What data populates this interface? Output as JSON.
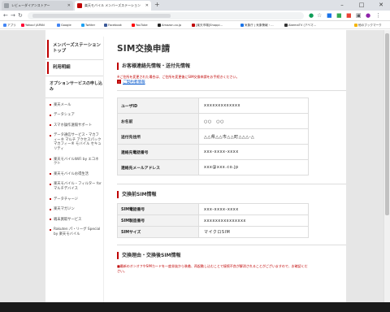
{
  "browser": {
    "tabs": [
      {
        "title": "レビューダイアンストアー",
        "active": false,
        "favicon_color": "#9aa0a6"
      },
      {
        "title": "楽天モバイル メンバーズステーション",
        "active": true,
        "favicon_color": "#bf0000"
      }
    ],
    "new_tab": "+",
    "window_controls": {
      "minimize": "–",
      "maximize": "□",
      "close": "✕"
    },
    "bookmarks": [
      {
        "label": "アプリ",
        "color": "#4285f4"
      },
      {
        "label": "Yahoo! JAPAN",
        "color": "#ff0033"
      },
      {
        "label": "Google",
        "color": "#4285f4"
      },
      {
        "label": "Twitter",
        "color": "#1da1f2"
      },
      {
        "label": "Facebook",
        "color": "#3b5998"
      },
      {
        "label": "YouTube",
        "color": "#ff0000"
      },
      {
        "label": "Amazon.co.jp",
        "color": "#222222"
      },
      {
        "label": "[楽天市場]Shoppi...",
        "color": "#bf0000"
      },
      {
        "label": "気象庁 | 気象警報・...",
        "color": "#1a73e8"
      },
      {
        "label": "AbemaTV (アベマ...",
        "color": "#333333"
      }
    ],
    "other_bookmarks": "他のブックマーク"
  },
  "sidebar": {
    "header": "メンバーズステーショントップ",
    "usage": "利用明細",
    "options_header": "オプションサービスの申し込み",
    "items": [
      "楽天メール",
      "データシェア",
      "スマホ操作遠隔サポート",
      "データ通信サービス・マカフィー® マルチ アクセスパック マカフィー® モバイル セキュリティ",
      "楽天モバイルWiFi by エコネクト",
      "楽天モバイルお得生活",
      "楽天モバイル・フィルター for マルチデバイス",
      "データチャージ",
      "楽天マガジン",
      "端末買取サービス",
      "Rakuten パ・リーグ Special by 楽天モバイル"
    ]
  },
  "main": {
    "title": "SIM交換申請",
    "contact": {
      "heading": "お客様連絡先情報・送付先情報",
      "note": "※ご住所を変更された場合は、ご住所を変更後にSIM交換申請をお手続きください。",
      "link": "ご契約者情報",
      "rows": [
        {
          "label": "ユーザID",
          "value": "xxxxxxxxxxxxx"
        },
        {
          "label": "お名前",
          "value": "○○　○○"
        },
        {
          "label": "送付先住所",
          "value": "△△県△△市△△町△△△-△"
        },
        {
          "label": "連絡先電話番号",
          "value": "xxx-xxxx-xxxx"
        },
        {
          "label": "連絡先メールアドレス",
          "value": "xxx@xxx.co.jp"
        }
      ]
    },
    "sim_before": {
      "heading": "交換前SIM情報",
      "rows": [
        {
          "label": "SIM電話番号",
          "value": "xxx-xxxx-xxxx"
        },
        {
          "label": "SIM製造番号",
          "value": "xxxxxxxxxxxxxxx"
        },
        {
          "label": "SIMサイズ",
          "value": "マイクロSIM"
        }
      ]
    },
    "reason": {
      "heading": "交換理由・交換後SIM情報",
      "note": "■最新のオンオフやSIMカードを一度非抜から装着、再起動し込むことで接続不良が解消されることがございますので、お確認ください。"
    }
  }
}
